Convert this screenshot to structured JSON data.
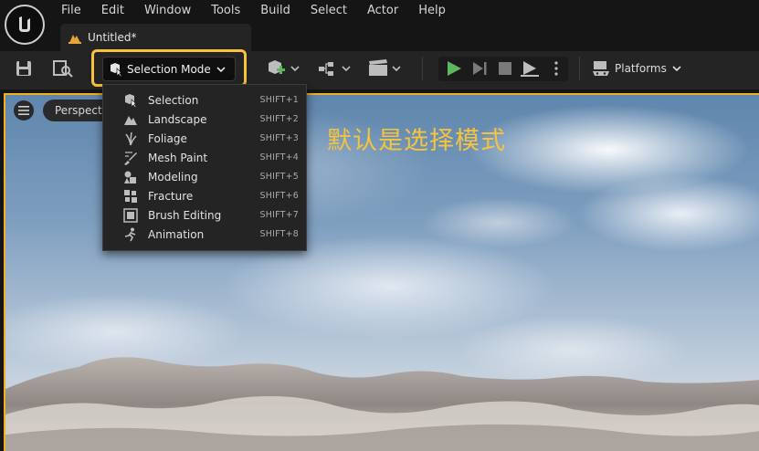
{
  "menubar": {
    "items": [
      "File",
      "Edit",
      "Window",
      "Tools",
      "Build",
      "Select",
      "Actor",
      "Help"
    ]
  },
  "document_tab": {
    "title": "Untitled*"
  },
  "toolbar": {
    "mode_button_label": "Selection Mode",
    "platforms_label": "Platforms"
  },
  "viewport": {
    "perspective_label": "Perspective",
    "annotation": "默认是选择模式"
  },
  "mode_menu": {
    "items": [
      {
        "label": "Selection",
        "shortcut": "SHIFT+1",
        "icon": "selection-icon"
      },
      {
        "label": "Landscape",
        "shortcut": "SHIFT+2",
        "icon": "landscape-icon"
      },
      {
        "label": "Foliage",
        "shortcut": "SHIFT+3",
        "icon": "foliage-icon"
      },
      {
        "label": "Mesh Paint",
        "shortcut": "SHIFT+4",
        "icon": "mesh-paint-icon"
      },
      {
        "label": "Modeling",
        "shortcut": "SHIFT+5",
        "icon": "modeling-icon"
      },
      {
        "label": "Fracture",
        "shortcut": "SHIFT+6",
        "icon": "fracture-icon"
      },
      {
        "label": "Brush Editing",
        "shortcut": "SHIFT+7",
        "icon": "brush-editing-icon"
      },
      {
        "label": "Animation",
        "shortcut": "SHIFT+8",
        "icon": "animation-icon"
      }
    ]
  },
  "colors": {
    "highlight": "#f7c33b",
    "annotation": "#f5c43c",
    "play_green": "#5cb85c",
    "asset_tab_orange": "#e8a33a"
  }
}
